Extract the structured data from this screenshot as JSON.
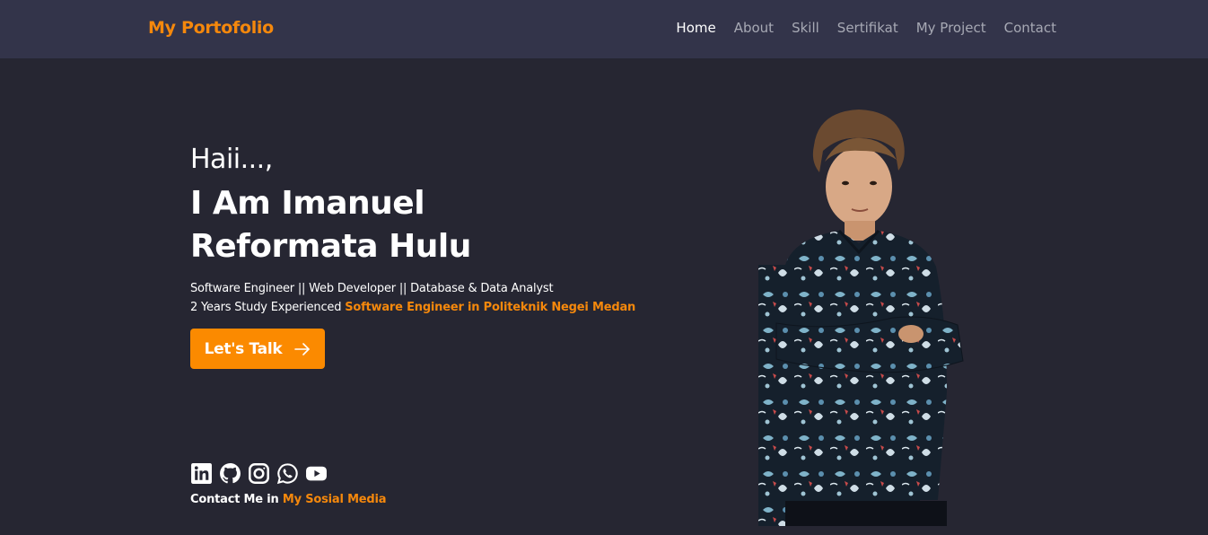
{
  "navbar": {
    "brand": "My Portofolio",
    "links": [
      {
        "label": "Home",
        "active": true
      },
      {
        "label": "About"
      },
      {
        "label": "Skill"
      },
      {
        "label": "Sertifikat"
      },
      {
        "label": "My Project"
      },
      {
        "label": "Contact"
      }
    ]
  },
  "hero": {
    "greeting": "Haii...,",
    "name_line1": "I Am Imanuel",
    "name_line2": "Reformata Hulu",
    "roles": "Software Engineer || Web Developer || Database & Data Analyst",
    "experience_prefix": "2 Years Study Experienced",
    "experience_highlight": "Software Engineer in Politeknik Negei Medan",
    "cta_label": "Let's Talk",
    "cta_icon": "arrow-right-icon"
  },
  "social": {
    "icons": [
      "linkedin-icon",
      "github-icon",
      "instagram-icon",
      "whatsapp-icon",
      "youtube-icon"
    ],
    "contact_prefix": "Contact Me in",
    "contact_highlight": "My Sosial Media"
  },
  "colors": {
    "accent": "#f5880c",
    "navbar_bg": "#33344a",
    "page_bg": "#262632",
    "nav_inactive": "#a7a9b4"
  }
}
